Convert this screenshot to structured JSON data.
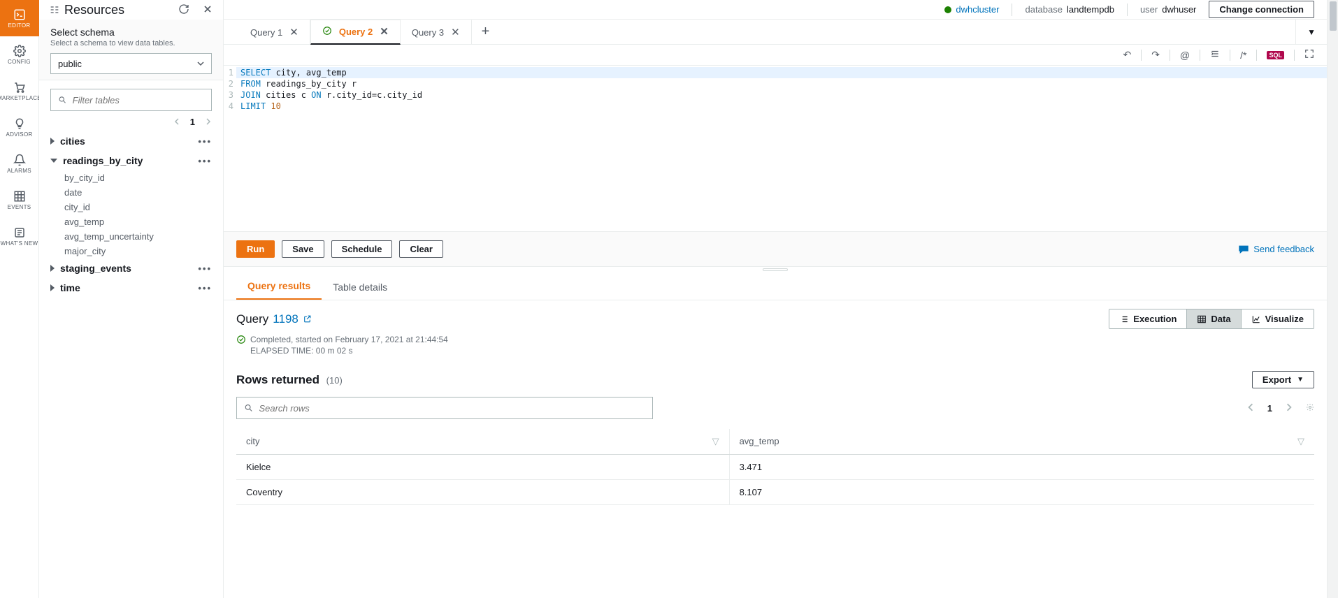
{
  "vnav": [
    {
      "label": "EDITOR",
      "icon": "editor"
    },
    {
      "label": "CONFIG",
      "icon": "gear"
    },
    {
      "label": "MARKETPLACE",
      "icon": "cart"
    },
    {
      "label": "ADVISOR",
      "icon": "bulb"
    },
    {
      "label": "ALARMS",
      "icon": "bell"
    },
    {
      "label": "EVENTS",
      "icon": "grid"
    },
    {
      "label": "WHAT'S NEW",
      "icon": "news"
    }
  ],
  "resources": {
    "title": "Resources",
    "schema_label": "Select schema",
    "schema_desc": "Select a schema to view data tables.",
    "schema_selected": "public",
    "filter_placeholder": "Filter tables",
    "page": "1",
    "tables": [
      {
        "name": "cities",
        "expanded": false,
        "columns": []
      },
      {
        "name": "readings_by_city",
        "expanded": true,
        "columns": [
          "by_city_id",
          "date",
          "city_id",
          "avg_temp",
          "avg_temp_uncertainty",
          "major_city"
        ]
      },
      {
        "name": "staging_events",
        "expanded": false,
        "columns": []
      },
      {
        "name": "time",
        "expanded": false,
        "columns": []
      }
    ]
  },
  "topbar": {
    "cluster": "dwhcluster",
    "db_label": "database",
    "db": "landtempdb",
    "user_label": "user",
    "user": "dwhuser",
    "change": "Change connection"
  },
  "tabs": [
    {
      "label": "Query 1",
      "status": null
    },
    {
      "label": "Query 2",
      "status": "ok"
    },
    {
      "label": "Query 3",
      "status": null
    }
  ],
  "active_tab": 1,
  "sql": [
    {
      "tokens": [
        {
          "t": "SELECT",
          "c": "kw"
        },
        {
          "t": " city, avg_temp"
        }
      ]
    },
    {
      "tokens": [
        {
          "t": "FROM",
          "c": "kw"
        },
        {
          "t": " readings_by_city r"
        }
      ]
    },
    {
      "tokens": [
        {
          "t": "JOIN",
          "c": "kw"
        },
        {
          "t": " cities c "
        },
        {
          "t": "ON",
          "c": "kw"
        },
        {
          "t": " r.city_id=c.city_id"
        }
      ]
    },
    {
      "tokens": [
        {
          "t": "LIMIT",
          "c": "kw"
        },
        {
          "t": " "
        },
        {
          "t": "10",
          "c": "num"
        }
      ]
    }
  ],
  "actions": {
    "run": "Run",
    "save": "Save",
    "schedule": "Schedule",
    "clear": "Clear",
    "feedback": "Send feedback"
  },
  "result_tabs": {
    "results": "Query results",
    "details": "Table details"
  },
  "query": {
    "label": "Query",
    "id": "1198",
    "status": "Completed, started on February 17, 2021 at 21:44:54",
    "elapsed": "ELAPSED TIME: 00 m 02 s",
    "views": {
      "execution": "Execution",
      "data": "Data",
      "visualize": "Visualize"
    }
  },
  "rows": {
    "title": "Rows returned",
    "count": "(10)",
    "export": "Export",
    "search_placeholder": "Search rows",
    "page": "1",
    "columns": [
      "city",
      "avg_temp"
    ],
    "data": [
      {
        "city": "Kielce",
        "avg_temp": "3.471"
      },
      {
        "city": "Coventry",
        "avg_temp": "8.107"
      }
    ]
  }
}
